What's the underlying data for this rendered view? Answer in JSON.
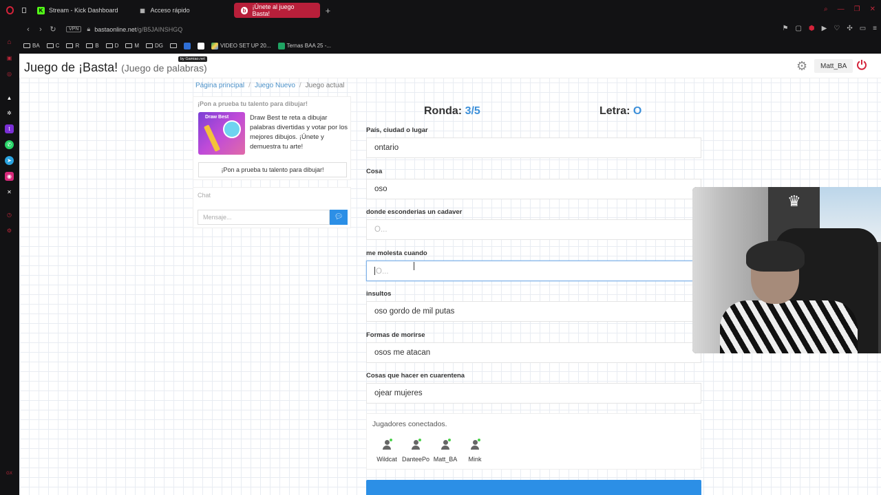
{
  "browser": {
    "tabs": [
      {
        "label": "Stream - Kick Dashboard",
        "icon": "kick-icon"
      },
      {
        "label": "Acceso rápido",
        "icon": "grid-icon"
      },
      {
        "label": "¡Únete al juego Basta!",
        "icon": "basta-icon",
        "active": true
      }
    ],
    "vpn_label": "VPN",
    "url_host": "bastaonline.net",
    "url_path": "/g/B5JAINSHGQ",
    "bookmarks": [
      "BA",
      "C",
      "R",
      "B",
      "D",
      "M",
      "DG",
      "VIDEO SET UP 20...",
      "Ternas BAA 25 -..."
    ]
  },
  "site": {
    "title": "Juego de ¡Basta!",
    "subtitle": "(Juego de palabras)",
    "badge": "by Gamiao.net",
    "username": "Matt_BA"
  },
  "breadcrumb": [
    "Página principal",
    "Juego Nuevo",
    "Juego actual"
  ],
  "promo": {
    "header": "¡Pon a prueba tu talento para dibujar!",
    "image_title": "Draw Best",
    "text": "Draw Best te reta a dibujar palabras divertidas y votar por los mejores dibujos. ¡Únete y demuestra tu arte!",
    "button": "¡Pon a prueba tu talento para dibujar!"
  },
  "chat": {
    "title": "Chat",
    "placeholder": "Mensaje..."
  },
  "game": {
    "ronda_label": "Ronda:",
    "ronda_value": "3/5",
    "letra_label": "Letra:",
    "letra_value": "O",
    "fields": [
      {
        "label": "País, ciudad o lugar",
        "value": "ontario"
      },
      {
        "label": "Cosa",
        "value": "oso"
      },
      {
        "label": "donde esconderias un cadaver",
        "value": "",
        "placeholder": "O..."
      },
      {
        "label": "me molesta cuando",
        "value": "",
        "placeholder": "O...",
        "focused": true
      },
      {
        "label": "insultos",
        "value": "oso gordo de mil putas"
      },
      {
        "label": "Formas de morirse",
        "value": "osos me atacan"
      },
      {
        "label": "Cosas que hacer en cuarentena",
        "value": "ojear mujeres"
      }
    ]
  },
  "players": {
    "title": "Jugadores conectados.",
    "list": [
      "Wildcat",
      "DanteePo",
      "Matt_BA",
      "Mink"
    ]
  },
  "colors": {
    "accent": "#2c8fe6",
    "tab_active": "#b81f3a",
    "online_dot": "#4bd14b"
  }
}
